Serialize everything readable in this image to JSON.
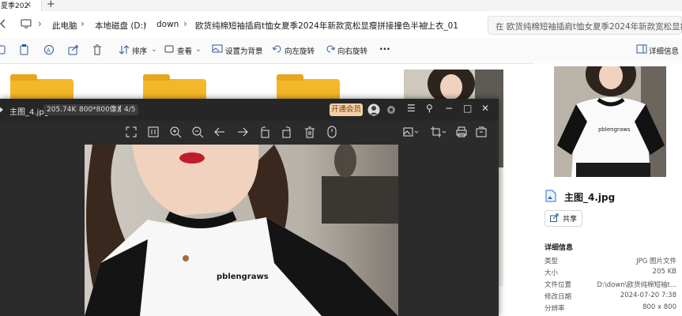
{
  "window": {
    "tab_title": "夏季202",
    "tab_close": "×",
    "new_tab": "+"
  },
  "breadcrumb": {
    "items": [
      "此电脑",
      "本地磁盘 (D:)",
      "down",
      "欧货纯棉短袖插肩t恤女夏季2024年新款宽松显瘦拼接撞色半袖上衣_01"
    ]
  },
  "search": {
    "placeholder": "在 欧货纯棉短袖插肩t恤女夏季2024年新款宽松显瘦"
  },
  "toolbar": {
    "sort": "排序",
    "view": "查看",
    "set_background": "设置为背景",
    "rotate_left": "向左旋转",
    "rotate_right": "向右旋转",
    "more": "···",
    "details": "详细信息"
  },
  "viewer": {
    "file_name": "主图_4.jpg",
    "file_size": "205.74K",
    "dimensions": "800*800像素",
    "index": "4/5",
    "vip_button": "开通会员",
    "shirt_text": "pblengraws"
  },
  "details_pane": {
    "file_name": "主图_4.jpg",
    "share": "共享",
    "section_title": "详细信息",
    "rows": [
      {
        "label": "类型",
        "value": "JPG 图片文件"
      },
      {
        "label": "大小",
        "value": "205 KB"
      },
      {
        "label": "文件位置",
        "value": "D:\\down\\欧货纯棉短袖t..."
      },
      {
        "label": "修改日期",
        "value": "2024-07-20 7:38"
      },
      {
        "label": "分辨率",
        "value": "800 x 800"
      }
    ]
  },
  "colors": {
    "folder": "#f5b72a",
    "viewer_bg": "#2b2b2b",
    "vip_bg": "#f3d0a8",
    "accent": "#2b5b9a"
  }
}
